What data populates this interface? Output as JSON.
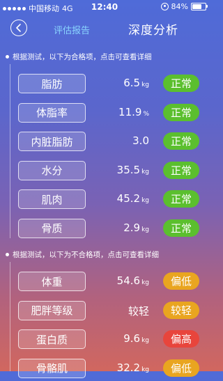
{
  "status_bar": {
    "carrier": "中国移动",
    "network": "4G",
    "time": "12:40",
    "battery": "84%",
    "battery_level": 0.84
  },
  "nav": {
    "report_label": "评估报告",
    "title": "深度分析"
  },
  "qualified": {
    "heading": "根据测试，以下为合格项，点击可查看详细",
    "items": [
      {
        "label": "脂肪",
        "value": "6.5",
        "unit": "kg",
        "status": "正常",
        "status_type": "normal"
      },
      {
        "label": "体脂率",
        "value": "11.9",
        "unit": "%",
        "status": "正常",
        "status_type": "normal"
      },
      {
        "label": "内脏脂肪",
        "value": "3.0",
        "unit": "",
        "status": "正常",
        "status_type": "normal"
      },
      {
        "label": "水分",
        "value": "35.5",
        "unit": "kg",
        "status": "正常",
        "status_type": "normal"
      },
      {
        "label": "肌肉",
        "value": "45.2",
        "unit": "kg",
        "status": "正常",
        "status_type": "normal"
      },
      {
        "label": "骨质",
        "value": "2.9",
        "unit": "kg",
        "status": "正常",
        "status_type": "normal"
      }
    ]
  },
  "unqualified": {
    "heading": "根据测试，以下为不合格项，点击可查看详细",
    "items": [
      {
        "label": "体重",
        "value": "54.6",
        "unit": "kg",
        "status": "偏低",
        "status_type": "low"
      },
      {
        "label": "肥胖等级",
        "value": "较轻",
        "unit": "",
        "status": "较轻",
        "status_type": "mild"
      },
      {
        "label": "蛋白质",
        "value": "9.6",
        "unit": "kg",
        "status": "偏高",
        "status_type": "high"
      },
      {
        "label": "骨骼肌",
        "value": "32.2",
        "unit": "kg",
        "status": "偏低",
        "status_type": "low"
      }
    ]
  },
  "colors": {
    "normal": "#5bbf2e",
    "low": "#e9a520",
    "high": "#e8453c",
    "report_link": "#8ad6ff"
  }
}
